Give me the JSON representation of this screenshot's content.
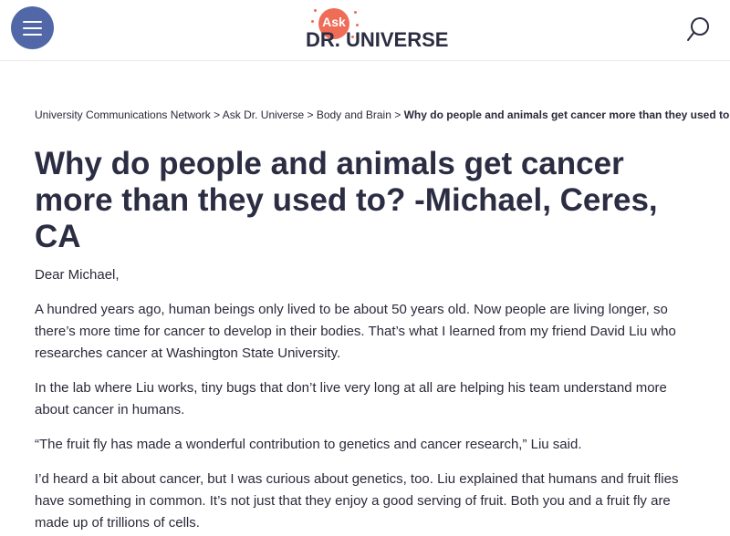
{
  "header": {
    "logo": {
      "ask": "Ask",
      "name": "DR. UNIVERSE"
    },
    "menu_icon": "hamburger-menu-icon",
    "search_icon": "search-icon",
    "menu_color": "#5167a8",
    "logo_accent_color": "#ef6c57"
  },
  "breadcrumb": {
    "items": [
      "University Communications Network",
      "Ask Dr. Universe",
      "Body and Brain"
    ],
    "separator": ">",
    "current": "Why do people and animals get cancer more than they used to?"
  },
  "article": {
    "title": "Why do people and animals get cancer more than they used to?  -Michael, Ceres, CA",
    "paragraphs": [
      "Dear Michael,",
      "A hundred years ago, human beings only lived to be about 50 years old. Now people are living longer, so there’s more time for cancer to develop in their bodies. That’s what I learned from my friend David Liu who researches cancer at Washington State University.",
      "In the lab where Liu works, tiny bugs that don’t live very long at all are helping his team understand more about cancer in humans.",
      "“The fruit fly has made a wonderful contribution to genetics and cancer research,” Liu said.",
      "I’d heard a bit about cancer, but I was curious about genetics, too. Liu explained that humans and fruit flies have something in common. It’s not just that they enjoy a good serving of fruit. Both you and a fruit fly are made up of trillions of cells."
    ]
  }
}
